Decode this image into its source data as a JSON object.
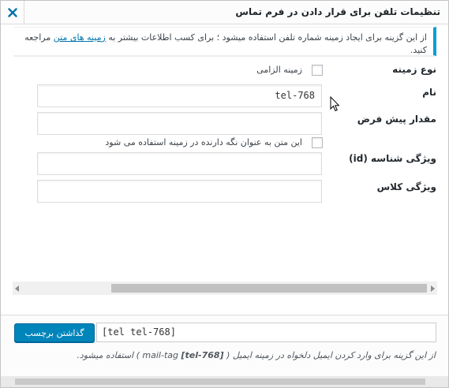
{
  "dialog": {
    "title": "تنظیمات تلفن برای قرار دادن در فرم تماس",
    "close_label": "×"
  },
  "notice": {
    "text_before": "از این گزینه برای ایجاد زمینه شماره تلفن استفاده میشود ؛ برای کسب اطلاعات بیشتر به ",
    "link_text": "زمینه های متن",
    "text_after": " مراجعه کنید."
  },
  "form": {
    "field_type_label": "نوع زمینه",
    "required_label": "زمینه الزامی",
    "name_label": "نام",
    "name_value": "tel-768",
    "default_label": "مقدار پیش فرض",
    "default_value": "",
    "placeholder_label": "این متن به عنوان نگه دارنده در زمینه استفاده می شود",
    "id_label": "ویژگی شناسه (id)",
    "id_value": "",
    "class_label": "ویژگی کلاس",
    "class_value": ""
  },
  "footer": {
    "insert_button": "گذاشتن برچسب",
    "tag_value": "[tel tel-768]",
    "hint_before": "از این گزینه برای وارد کردن ایمیل دلخواه در زمینه ایمیل ( ",
    "hint_tag": "[tel-768]",
    "hint_after": " mail-tag ) استفاده میشود."
  }
}
